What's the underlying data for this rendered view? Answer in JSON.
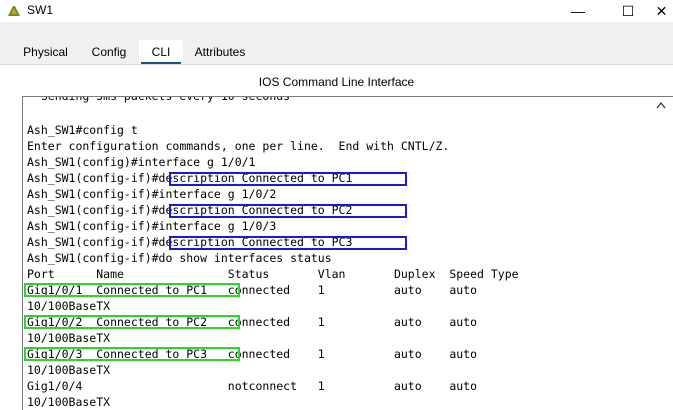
{
  "window": {
    "title": "SW1",
    "minimize_glyph": "—",
    "maximize_glyph": "☐",
    "close_glyph": "✕"
  },
  "tabs": [
    {
      "label": "Physical"
    },
    {
      "label": "Config"
    },
    {
      "label": "CLI",
      "active": true
    },
    {
      "label": "Attributes"
    }
  ],
  "cli": {
    "heading": "IOS Command Line Interface",
    "clipped_line": "  Sending 5ms packets every 10 seconds",
    "lines": [
      "Ash_SW1#config t",
      "Enter configuration commands, one per line.  End with CNTL/Z.",
      "Ash_SW1(config)#interface g 1/0/1",
      "Ash_SW1(config-if)#description Connected to PC1",
      "Ash_SW1(config-if)#interface g 1/0/2",
      "Ash_SW1(config-if)#description Connected to PC2",
      "Ash_SW1(config-if)#interface g 1/0/3",
      "Ash_SW1(config-if)#description Connected to PC3",
      "Ash_SW1(config-if)#do show interfaces status",
      "Port      Name               Status       Vlan       Duplex  Speed Type",
      "Gig1/0/1  Connected to PC1   connected    1          auto    auto",
      "10/100BaseTX",
      "Gig1/0/2  Connected to PC2   connected    1          auto    auto",
      "10/100BaseTX",
      "Gig1/0/3  Connected to PC3   connected    1          auto    auto",
      "10/100BaseTX",
      "Gig1/0/4                     notconnect   1          auto    auto",
      "10/100BaseTX"
    ]
  },
  "colors": {
    "description_highlight": "#1a1ad6",
    "status_highlight": "#2bd62b",
    "active_tab_underline": "#1e4e8c"
  },
  "icons": {
    "app": "packet-tracer-switch-icon",
    "scroll_up": "chevron-up-icon"
  }
}
